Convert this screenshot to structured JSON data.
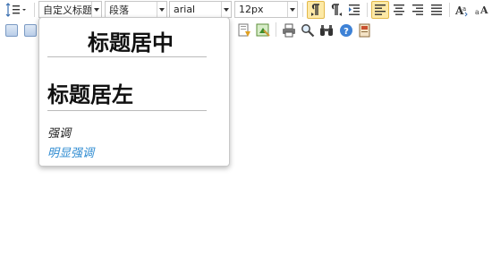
{
  "toolbar": {
    "custom_style": {
      "value": "自定义标题"
    },
    "paragraph": {
      "value": "段落"
    },
    "font_family": {
      "value": "arial"
    },
    "font_size": {
      "value": "12px"
    }
  },
  "style_menu": {
    "items": [
      {
        "label": "标题居中"
      },
      {
        "label": "标题居左"
      },
      {
        "label": "强调"
      },
      {
        "label": "明显强调"
      }
    ]
  },
  "colors": {
    "active_bg": "#fde9a6",
    "accent_blue": "#2e8bd1"
  }
}
